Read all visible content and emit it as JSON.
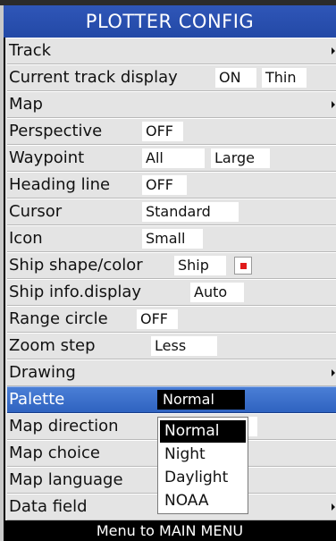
{
  "title": "PLOTTER CONFIG",
  "rows": [
    {
      "label": "Track",
      "submenu": true
    },
    {
      "label": "Current track display",
      "values": [
        "ON",
        "Thin"
      ]
    },
    {
      "label": "Map",
      "submenu": true
    },
    {
      "label": "Perspective",
      "values": [
        "OFF"
      ]
    },
    {
      "label": "Waypoint",
      "values": [
        "All",
        "Large"
      ]
    },
    {
      "label": "Heading line",
      "values": [
        "OFF"
      ]
    },
    {
      "label": "Cursor",
      "values": [
        "Standard"
      ]
    },
    {
      "label": "Icon",
      "values": [
        "Small"
      ]
    },
    {
      "label": "Ship shape/color",
      "values": [
        "Ship"
      ],
      "color_swatch": "#e01b1b"
    },
    {
      "label": "Ship info.display",
      "values": [
        "Auto"
      ]
    },
    {
      "label": "Range circle",
      "values": [
        "OFF"
      ]
    },
    {
      "label": "Zoom step",
      "values": [
        "Less"
      ]
    },
    {
      "label": "Drawing",
      "submenu": true
    },
    {
      "label": "Palette",
      "values": [
        "Normal"
      ],
      "selected": true
    },
    {
      "label": "Map direction"
    },
    {
      "label": "Map choice"
    },
    {
      "label": "Map language"
    },
    {
      "label": "Data field",
      "submenu": true
    }
  ],
  "palette_dropdown": {
    "options": [
      "Normal",
      "Night",
      "Daylight",
      "NOAA"
    ],
    "active": "Normal"
  },
  "footer": "Menu to MAIN MENU",
  "colors": {
    "title_bar": "#2349a6",
    "selected_row": "#3a6ec8",
    "swatch": "#e01b1b"
  }
}
